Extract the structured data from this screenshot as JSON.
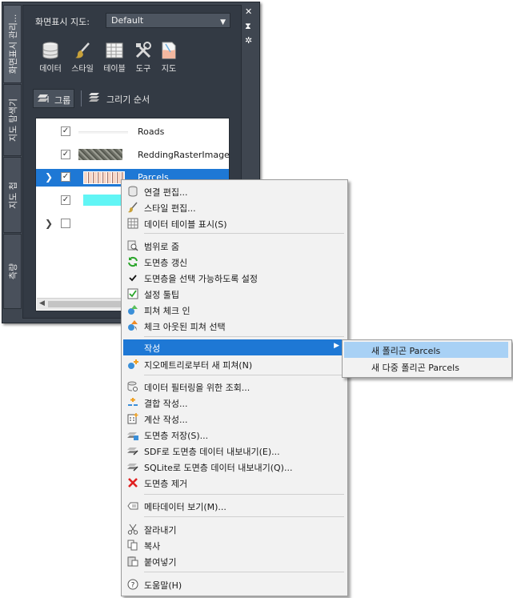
{
  "palette": {
    "vtabs": [
      "화면표시 관리...",
      "지도 탐색기",
      "지도 첩",
      "측량"
    ],
    "controls": {
      "close": "✕",
      "pin": "⧗",
      "settings": "✲"
    },
    "map_label": "화면표시 지도:",
    "map_value": "Default",
    "tools": [
      {
        "label": "데이터",
        "icon": "database-icon"
      },
      {
        "label": "스타일",
        "icon": "brush-icon"
      },
      {
        "label": "테이블",
        "icon": "table-icon"
      },
      {
        "label": "도구",
        "icon": "tools-icon"
      },
      {
        "label": "지도",
        "icon": "map-icon"
      }
    ],
    "group_button": "그룹",
    "draw_order_button": "그리기 순서",
    "layers": [
      {
        "name": "Roads",
        "checked": true,
        "expander": false,
        "selected": false
      },
      {
        "name": "ReddingRasterImage",
        "checked": true,
        "expander": false,
        "selected": false
      },
      {
        "name": "Parcels",
        "checked": true,
        "expander": true,
        "selected": true
      },
      {
        "name": "",
        "checked": true,
        "expander": false,
        "selected": false
      },
      {
        "name": "",
        "checked": false,
        "expander": true,
        "selected": false
      }
    ]
  },
  "menu": {
    "items": [
      {
        "label": "연결 편집...",
        "icon": "connection-icon"
      },
      {
        "label": "스타일 편집...",
        "icon": "brush-icon"
      },
      {
        "label": "데이터 테이블 표시(S)",
        "icon": "table-icon"
      },
      {
        "label": "범위로 줌",
        "icon": "zoom-extents-icon"
      },
      {
        "label": "도면층 갱신",
        "icon": "refresh-icon"
      },
      {
        "label": "도면층을 선택 가능하도록 설정",
        "icon": "checkmark-icon"
      },
      {
        "label": "설정 툴팁",
        "icon": "tooltip-icon"
      },
      {
        "label": "피쳐 체크 인",
        "icon": "checkin-icon"
      },
      {
        "label": "체크 아웃된 피쳐 선택",
        "icon": "checkout-icon"
      },
      {
        "label": "작성",
        "icon": ""
      },
      {
        "label": "지오메트리로부터 새 피쳐(N)",
        "icon": "new-feature-icon"
      },
      {
        "label": "데이터 필터링을 위한 조회...",
        "icon": "query-icon"
      },
      {
        "label": "결합 작성...",
        "icon": "join-icon"
      },
      {
        "label": "계산 작성...",
        "icon": "calculator-icon"
      },
      {
        "label": "도면층 저장(S)...",
        "icon": "save-layer-icon"
      },
      {
        "label": "SDF로 도면층 데이터 내보내기(E)...",
        "icon": "export-sdf-icon"
      },
      {
        "label": "SQLite로 도면층 데이터 내보내기(Q)...",
        "icon": "export-sqlite-icon"
      },
      {
        "label": "도면층 제거",
        "icon": "remove-icon"
      },
      {
        "label": "메타데이터 보기(M)...",
        "icon": "metadata-icon"
      },
      {
        "label": "잘라내기",
        "icon": "scissors-icon"
      },
      {
        "label": "복사",
        "icon": "copy-icon"
      },
      {
        "label": "붙여넣기",
        "icon": "paste-icon"
      },
      {
        "label": "도움말(H)",
        "icon": "help-icon"
      }
    ],
    "submenu": [
      "새 폴리곤 Parcels",
      "새 다중 폴리곤 Parcels"
    ]
  },
  "colors": {
    "accent": "#1e78d5",
    "submenu_highlight": "#a8d1f5",
    "panel_bg": "#333a44"
  }
}
